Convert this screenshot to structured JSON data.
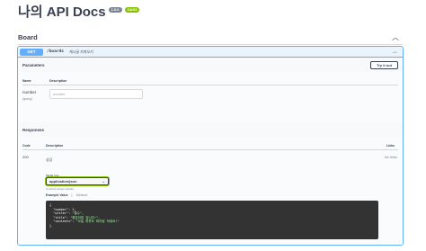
{
  "app": {
    "title": "나의 API Docs",
    "version_badge": "1.0.0",
    "spec_badge": "OAS3"
  },
  "tag": {
    "name": "Board",
    "collapse_icon": "chevron-up-icon"
  },
  "operation": {
    "method": "GET",
    "path": "/boards",
    "summary": "게시글 가져오기",
    "collapse_icon": "chevron-up-icon"
  },
  "parameters": {
    "title": "Parameters",
    "try_button": "Try it out",
    "col_name": "Name",
    "col_description": "Description",
    "items": [
      {
        "name": "number",
        "location": "(query)",
        "placeholder": "number",
        "value": ""
      }
    ]
  },
  "responses": {
    "title": "Responses",
    "col_code": "Code",
    "col_description": "Description",
    "col_links": "Links",
    "items": [
      {
        "code": "200",
        "description": "성공",
        "links": "No links",
        "media_type_label": "Media type",
        "media_type": "application/json",
        "media_hint": "Controls Accept header.",
        "example_tab": "Example Value",
        "schema_tab": "Schema",
        "example": {
          "open": "{",
          "lines": [
            {
              "key": "\"number\"",
              "value": "1,"
            },
            {
              "key": "\"writer\"",
              "value": "\"철수\","
            },
            {
              "key": "\"title\"",
              "value": "\"좋은아침 입니다~\","
            },
            {
              "key": "\"contents\"",
              "value": "\"오늘 하루도 파이팅 하세요!\""
            }
          ],
          "close": "}"
        }
      }
    ]
  },
  "colors": {
    "get_method": "#61affe",
    "oas_badge": "#89bf04",
    "version_badge": "#7d8492",
    "code_bg": "#333333"
  }
}
